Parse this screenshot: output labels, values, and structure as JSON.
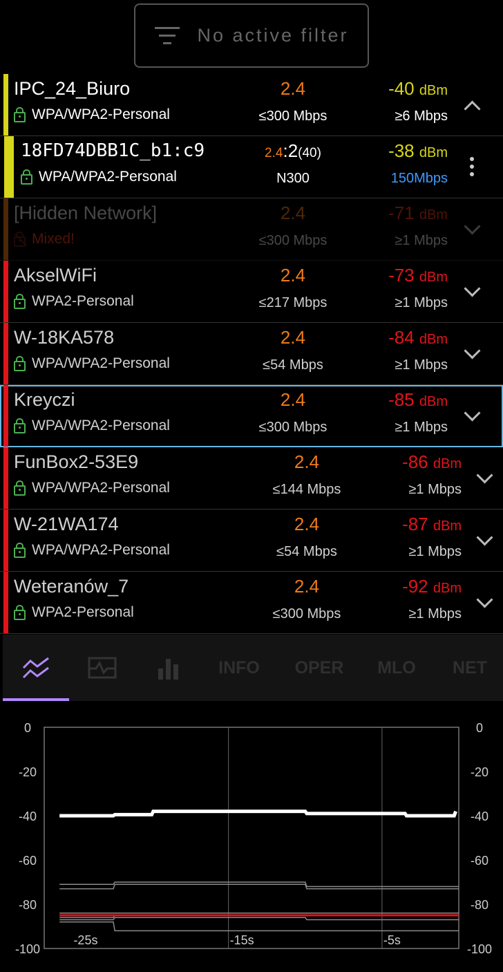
{
  "filter": {
    "label": "No active filter",
    "icon": "filter-icon"
  },
  "networks": [
    {
      "name": "IPC_24_Biuro",
      "security": "WPA/WPA2-Personal",
      "band": "2.4",
      "max_speed": "≤300 Mbps",
      "signal": "-40",
      "unit": "dBm",
      "min_speed": "≥6 Mbps",
      "bar_color": "#d6d61a",
      "signal_color": "#d6d61a",
      "expanded": true
    },
    {
      "name": "18FD74DBB1C_b1:c9",
      "security": "WPA/WPA2-Personal",
      "band_main": "2.4",
      "band_extra": ":2",
      "band_width": "(40)",
      "mode": "N300",
      "signal": "-38",
      "unit": "dBm",
      "rate": "150Mbps",
      "rate_color": "#3d9bff",
      "bar_color": "#d6d61a",
      "signal_color": "#d6d61a",
      "sub": true
    },
    {
      "name": "[Hidden Network]",
      "security": "Mixed!",
      "band": "2.4",
      "max_speed": "≤300 Mbps",
      "signal": "-71",
      "unit": "dBm",
      "min_speed": "≥1 Mbps",
      "bar_color": "#ef7b17",
      "signal_color": "#ef3b17",
      "faded": true
    },
    {
      "name": "AkselWiFi",
      "security": "WPA2-Personal",
      "band": "2.4",
      "max_speed": "≤217 Mbps",
      "signal": "-73",
      "unit": "dBm",
      "min_speed": "≥1 Mbps",
      "bar_color": "#e0141b",
      "signal_color": "#e0141b"
    },
    {
      "name": "W-18KA578",
      "security": "WPA/WPA2-Personal",
      "band": "2.4",
      "max_speed": "≤54 Mbps",
      "signal": "-84",
      "unit": "dBm",
      "min_speed": "≥1 Mbps",
      "bar_color": "#e0141b",
      "signal_color": "#e0141b"
    },
    {
      "name": "Kreyczi",
      "security": "WPA/WPA2-Personal",
      "band": "2.4",
      "max_speed": "≤300 Mbps",
      "signal": "-85",
      "unit": "dBm",
      "min_speed": "≥1 Mbps",
      "bar_color": "#e0141b",
      "signal_color": "#e0141b",
      "selected": true
    },
    {
      "name": "FunBox2-53E9",
      "security": "WPA/WPA2-Personal",
      "band": "2.4",
      "max_speed": "≤144 Mbps",
      "signal": "-86",
      "unit": "dBm",
      "min_speed": "≥1 Mbps",
      "bar_color": "#e0141b",
      "signal_color": "#e0141b",
      "shift": true
    },
    {
      "name": "W-21WA174",
      "security": "WPA/WPA2-Personal",
      "band": "2.4",
      "max_speed": "≤54 Mbps",
      "signal": "-87",
      "unit": "dBm",
      "min_speed": "≥1 Mbps",
      "bar_color": "#e0141b",
      "signal_color": "#e0141b",
      "shift": true
    },
    {
      "name": "Weteranów_7",
      "security": "WPA2-Personal",
      "band": "2.4",
      "max_speed": "≤300 Mbps",
      "signal": "-92",
      "unit": "dBm",
      "min_speed": "≥1 Mbps",
      "bar_color": "#e0141b",
      "signal_color": "#e0141b",
      "shift": true
    }
  ],
  "tabs": [
    {
      "name": "tab-time-graph",
      "icon": "time-graph-icon",
      "active": true
    },
    {
      "name": "tab-signal-graph",
      "icon": "signal-graph-icon"
    },
    {
      "name": "tab-channel-rating",
      "icon": "bar-chart-icon"
    },
    {
      "name": "tab-info",
      "label": "INFO"
    },
    {
      "name": "tab-oper",
      "label": "OPER"
    },
    {
      "name": "tab-mlo",
      "label": "MLO"
    },
    {
      "name": "tab-net",
      "label": "NET"
    }
  ],
  "chart_data": {
    "type": "line",
    "title": "",
    "xlabel": "",
    "ylabel": "",
    "ylim": [
      -100,
      0
    ],
    "xlim": [
      -27,
      0
    ],
    "y_ticks": [
      "0",
      "-20",
      "-40",
      "-60",
      "-80",
      "-100"
    ],
    "x_ticks": [
      {
        "x": -25,
        "label": "-25s"
      },
      {
        "x": -15,
        "label": "-15s"
      },
      {
        "x": -5,
        "label": "-5s"
      }
    ],
    "grid_x": [
      -15,
      -5
    ],
    "grid": true,
    "series": [
      {
        "color": "#ffffff",
        "width": 5,
        "x": [
          -26,
          -22.5,
          -22.4,
          -20,
          -19.9,
          -10,
          -9.9,
          -3.5,
          -3.4,
          -0.3,
          -0.2
        ],
        "y": [
          -40,
          -40,
          -39.5,
          -39.5,
          -38,
          -38,
          -39,
          -39,
          -40,
          -40,
          -38
        ]
      },
      {
        "color": "#8a8a8a",
        "width": 1.5,
        "x": [
          -26,
          -22.5,
          -22.4,
          -15.4,
          -15.3,
          -10,
          -9.9,
          -3.5,
          -3.4,
          0
        ],
        "y": [
          -71,
          -71,
          -70,
          -70,
          -70,
          -70,
          -72,
          -72,
          -72,
          -72
        ]
      },
      {
        "color": "#8a8a8a",
        "width": 1.5,
        "x": [
          -26,
          -22.5,
          -22.4,
          -10,
          -9.9,
          0
        ],
        "y": [
          -73,
          -73,
          -71,
          -71,
          -73,
          -73
        ]
      },
      {
        "color": "#8a8a8a",
        "width": 1.5,
        "x": [
          -26,
          -22.5,
          -22.4,
          0
        ],
        "y": [
          -84,
          -84,
          -84,
          -84
        ]
      },
      {
        "color": "#8a8a8a",
        "width": 1.5,
        "x": [
          -26,
          -22.5,
          -22.4,
          -10,
          -9.9,
          0
        ],
        "y": [
          -86,
          -86,
          -85,
          -85,
          -85,
          -85
        ]
      },
      {
        "color": "#e0141b",
        "width": 3,
        "x": [
          -26,
          -22.5,
          -22.4,
          0
        ],
        "y": [
          -85,
          -85,
          -85,
          -85
        ]
      },
      {
        "color": "#8a8a8a",
        "width": 1.5,
        "x": [
          -26,
          -22.5,
          -22.4,
          -10,
          -9.9,
          0
        ],
        "y": [
          -87,
          -87,
          -86,
          -86,
          -87,
          -87
        ]
      },
      {
        "color": "#8a8a8a",
        "width": 1.5,
        "x": [
          -26,
          -22.5,
          -22.4,
          0
        ],
        "y": [
          -88,
          -88,
          -92,
          -92
        ]
      }
    ]
  }
}
